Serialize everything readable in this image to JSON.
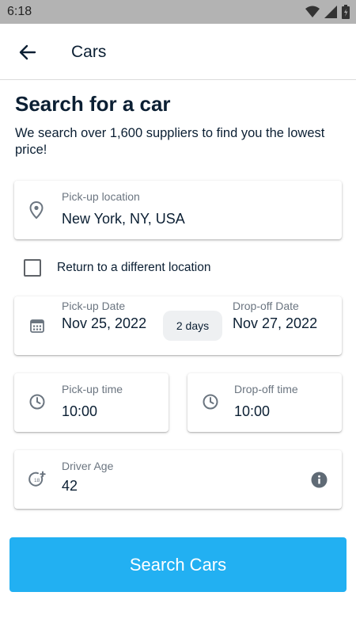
{
  "status_bar": {
    "time": "6:18"
  },
  "app_bar": {
    "title": "Cars"
  },
  "heading": "Search for a car",
  "subheading": "We search over 1,600 suppliers to find you the lowest price!",
  "pickup_location": {
    "label": "Pick-up location",
    "value": "New York, NY, USA"
  },
  "return_different": {
    "label": "Return to a different location",
    "checked": false
  },
  "dates": {
    "pickup_label": "Pick-up Date",
    "pickup_value": "Nov 25, 2022",
    "duration": "2 days",
    "dropoff_label": "Drop-off Date",
    "dropoff_value": "Nov 27, 2022"
  },
  "pickup_time": {
    "label": "Pick-up time",
    "value": "10:00"
  },
  "dropoff_time": {
    "label": "Drop-off time",
    "value": "10:00"
  },
  "driver_age": {
    "label": "Driver Age",
    "value": "42"
  },
  "search_button": {
    "label": "Search Cars"
  },
  "colors": {
    "accent": "#22b0f2",
    "text": "#0b1f33",
    "muted": "#6b7580",
    "status_bar": "#b3b3b3"
  },
  "icons": [
    "wifi-icon",
    "signal-icon",
    "battery-icon",
    "back-arrow-icon",
    "location-pin-icon",
    "calendar-icon",
    "clock-icon",
    "age-icon",
    "info-icon"
  ]
}
